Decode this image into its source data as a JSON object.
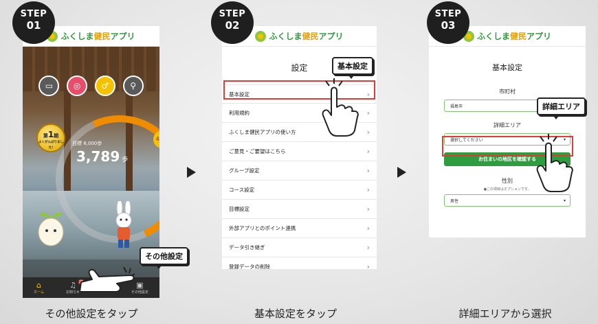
{
  "app": {
    "name_prefix": "ふくしま",
    "name_highlight": "健民",
    "name_suffix": "アプリ"
  },
  "steps": [
    {
      "word": "STEP",
      "number": "01",
      "caption": "その他設定をタップ",
      "callout": "その他設定",
      "top_icons": [
        {
          "icon": "card-icon",
          "label": "健民カード",
          "color": "#5a5a5a"
        },
        {
          "icon": "coin-icon",
          "label": "ポイント",
          "color": "#e84e6a"
        },
        {
          "icon": "walk-icon",
          "label": "ウォーキング",
          "color": "#f6c200"
        },
        {
          "icon": "bike-icon",
          "label": "サイクリング",
          "color": "#5a5a5a"
        }
      ],
      "medal": {
        "line1": "第",
        "big": "1",
        "line2": "期",
        "line3": "よくがんばりました!"
      },
      "steps_label": "目標 8,000歩",
      "steps_value": "3,789",
      "steps_unit": "歩",
      "goal_percent": "40%",
      "nav": [
        {
          "icon": "home-icon",
          "label": "ホーム",
          "badge": ""
        },
        {
          "icon": "bell-icon",
          "label": "お知らせ",
          "badge": "20"
        },
        {
          "icon": "chart-icon",
          "label": "",
          "badge": ""
        },
        {
          "icon": "more-icon",
          "label": "その他設定",
          "badge": ""
        }
      ]
    },
    {
      "word": "STEP",
      "number": "02",
      "caption": "基本設定をタップ",
      "callout": "基本設定",
      "title": "設定",
      "menu": [
        "基本設定",
        "利用規約",
        "ふくしま健民アプリの使い方",
        "ご意見・ご要望はこちら",
        "グループ設定",
        "コース設定",
        "目標設定",
        "外部アプリとのポイント連携",
        "データ引き継ぎ",
        "登録データの削除"
      ]
    },
    {
      "word": "STEP",
      "number": "03",
      "caption": "詳細エリアから選択",
      "callout": "詳細エリア",
      "title": "基本設定",
      "city_label": "市町村",
      "city_value": "福島市",
      "area_label": "詳細エリア",
      "area_value": "選択してください",
      "area_button": "お住まいの地区を確認する",
      "gender_label": "性別",
      "gender_note": "●この項目はオプションです。",
      "gender_value": "男性"
    }
  ],
  "colors": {
    "accent_red": "#e53935",
    "brand_green": "#2e9d3f",
    "progress_orange": "#f08c00"
  }
}
